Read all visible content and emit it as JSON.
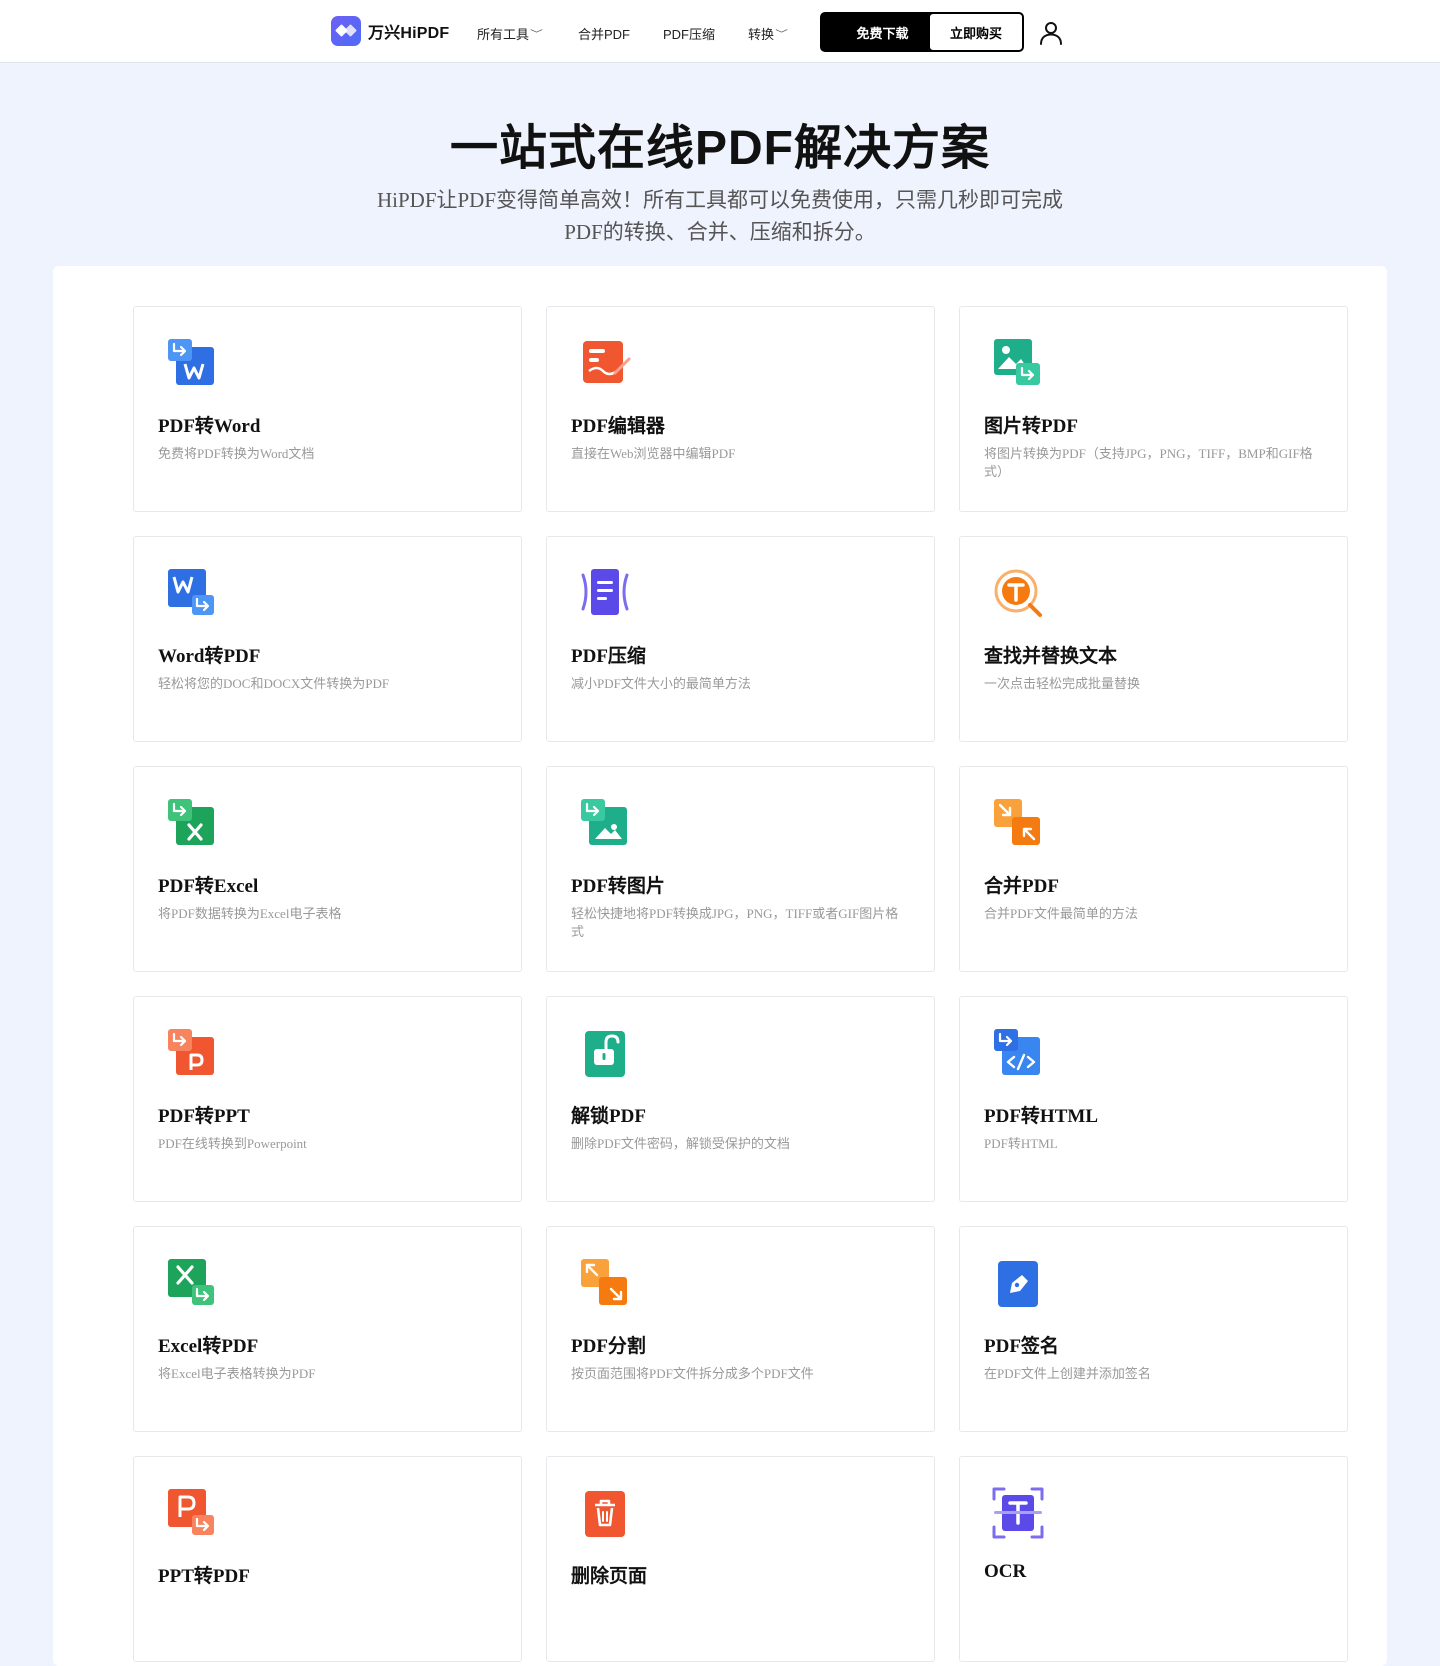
{
  "header": {
    "logo_text": "万兴HiPDF",
    "nav": [
      {
        "label": "所有工具",
        "has_dropdown": true
      },
      {
        "label": "合并PDF",
        "has_dropdown": false
      },
      {
        "label": "PDF压缩",
        "has_dropdown": false
      },
      {
        "label": "转换",
        "has_dropdown": true
      }
    ],
    "download_label": "免费下载",
    "buy_label": "立即购买",
    "user_icon": "user-icon"
  },
  "hero": {
    "title": "一站式在线PDF解决方案",
    "subtitle_line1": "HiPDF让PDF变得简单高效！所有工具都可以免费使用，只需几秒即可完成",
    "subtitle_line2": "PDF的转换、合并、压缩和拆分。"
  },
  "tools": [
    {
      "title": "PDF转Word",
      "desc": "免费将PDF转换为Word文档",
      "icon": "pdf-to-word-icon",
      "color": "#2f6fe4"
    },
    {
      "title": "PDF编辑器",
      "desc": "直接在Web浏览器中编辑PDF",
      "icon": "pdf-editor-icon",
      "color": "#f0562f"
    },
    {
      "title": "图片转PDF",
      "desc": "将图片转换为PDF（支持JPG，PNG，TIFF，BMP和GIF格式）",
      "icon": "image-to-pdf-icon",
      "color": "#1eae8a"
    },
    {
      "title": "Word转PDF",
      "desc": "轻松将您的DOC和DOCX文件转换为PDF",
      "icon": "word-to-pdf-icon",
      "color": "#2f6fe4"
    },
    {
      "title": "PDF压缩",
      "desc": "减小PDF文件大小的最简单方法",
      "icon": "pdf-compress-icon",
      "color": "#5b49e8"
    },
    {
      "title": "查找并替换文本",
      "desc": "一次点击轻松完成批量替换",
      "icon": "find-replace-text-icon",
      "color": "#f57a10"
    },
    {
      "title": "PDF转Excel",
      "desc": "将PDF数据转换为Excel电子表格",
      "icon": "pdf-to-excel-icon",
      "color": "#1ea35a"
    },
    {
      "title": "PDF转图片",
      "desc": "轻松快捷地将PDF转换成JPG，PNG，TIFF或者GIF图片格式",
      "icon": "pdf-to-image-icon",
      "color": "#1eae8a"
    },
    {
      "title": "合并PDF",
      "desc": "合并PDF文件最简单的方法",
      "icon": "merge-pdf-icon",
      "color": "#f57a10"
    },
    {
      "title": "PDF转PPT",
      "desc": "PDF在线转换到Powerpoint",
      "icon": "pdf-to-ppt-icon",
      "color": "#f0562f"
    },
    {
      "title": "解锁PDF",
      "desc": "删除PDF文件密码，解锁受保护的文档",
      "icon": "unlock-pdf-icon",
      "color": "#1eae8a"
    },
    {
      "title": "PDF转HTML",
      "desc": "PDF转HTML",
      "icon": "pdf-to-html-icon",
      "color": "#2f6fe4"
    },
    {
      "title": "Excel转PDF",
      "desc": "将Excel电子表格转换为PDF",
      "icon": "excel-to-pdf-icon",
      "color": "#1ea35a"
    },
    {
      "title": "PDF分割",
      "desc": "按页面范围将PDF文件拆分成多个PDF文件",
      "icon": "split-pdf-icon",
      "color": "#f57a10"
    },
    {
      "title": "PDF签名",
      "desc": "在PDF文件上创建并添加签名",
      "icon": "sign-pdf-icon",
      "color": "#2f6fe4"
    },
    {
      "title": "PPT转PDF",
      "desc": "",
      "icon": "ppt-to-pdf-icon",
      "color": "#f0562f"
    },
    {
      "title": "删除页面",
      "desc": "",
      "icon": "delete-pages-icon",
      "color": "#f0562f"
    },
    {
      "title": "OCR",
      "desc": "",
      "icon": "ocr-icon",
      "color": "#5b49e8"
    }
  ]
}
